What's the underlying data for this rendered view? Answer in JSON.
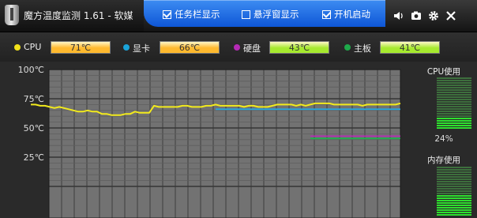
{
  "window": {
    "title": "魔方温度监测 1.61 - 软媒"
  },
  "options": [
    {
      "label": "任务栏显示",
      "checked": true
    },
    {
      "label": "悬浮窗显示",
      "checked": false
    },
    {
      "label": "开机启动",
      "checked": true
    }
  ],
  "toolbar_icons": [
    "speaker-icon",
    "camera-icon",
    "gear-icon",
    "close-icon"
  ],
  "sensors": [
    {
      "label": "CPU",
      "value": "71℃",
      "dot_color": "#f2e21a",
      "bar_color": "#ffb92e"
    },
    {
      "label": "显卡",
      "value": "66℃",
      "dot_color": "#1aa3d9",
      "bar_color": "#ffb92e"
    },
    {
      "label": "硬盘",
      "value": "43℃",
      "dot_color": "#b52ab5",
      "bar_color": "#a6ea2e"
    },
    {
      "label": "主板",
      "value": "41℃",
      "dot_color": "#1ea94a",
      "bar_color": "#a6ea2e"
    }
  ],
  "chart_data": {
    "type": "line",
    "y_ticks": [
      "100℃",
      "75℃",
      "50℃",
      "25℃"
    ],
    "ylim": [
      0,
      100
    ],
    "grid": true,
    "series": [
      {
        "name": "CPU",
        "color": "#f2ea1c",
        "values": [
          70,
          70,
          69,
          69,
          68,
          67,
          68,
          67,
          66,
          65,
          64,
          64,
          65,
          64,
          64,
          62,
          62,
          61,
          61,
          61,
          62,
          62,
          64,
          63,
          63,
          63,
          69,
          68,
          68,
          68,
          68,
          68,
          69,
          69,
          68,
          68,
          68,
          69,
          69,
          70,
          69,
          69,
          69,
          69,
          69,
          68,
          69,
          69,
          68,
          68,
          68,
          69,
          70,
          70,
          70,
          70,
          69,
          70,
          69,
          70,
          71,
          71,
          71,
          71,
          70,
          70,
          70,
          70,
          70,
          70,
          69,
          70,
          70,
          70,
          70,
          70,
          70,
          70,
          71
        ]
      },
      {
        "name": "显卡",
        "color": "#27a7df",
        "values": [
          66,
          66,
          66,
          66,
          66,
          66,
          66,
          66,
          66,
          66,
          66,
          66,
          66,
          66,
          66,
          66,
          66,
          66,
          66,
          66,
          66,
          66,
          66,
          66,
          66,
          66,
          66,
          66,
          66,
          66,
          66,
          66,
          66,
          66,
          66,
          66,
          66,
          66,
          66,
          66
        ]
      },
      {
        "name": "硬盘",
        "color": "#b22fb2",
        "values": [
          43,
          43,
          43,
          43,
          43,
          43,
          43,
          43,
          43,
          43,
          43,
          43,
          43,
          43,
          43,
          43,
          43,
          43,
          43,
          43
        ]
      },
      {
        "name": "主板",
        "color": "#1eb14e",
        "values": [
          41,
          41,
          41,
          41,
          41,
          41,
          41,
          41,
          41,
          41,
          41,
          41,
          41,
          41,
          41,
          41,
          41,
          41,
          41,
          41
        ]
      }
    ]
  },
  "side": {
    "cpu_title": "CPU使用",
    "cpu_value": "24%",
    "cpu_usage": 0.24,
    "mem_title": "内存使用",
    "mem_usage": 0.45
  }
}
